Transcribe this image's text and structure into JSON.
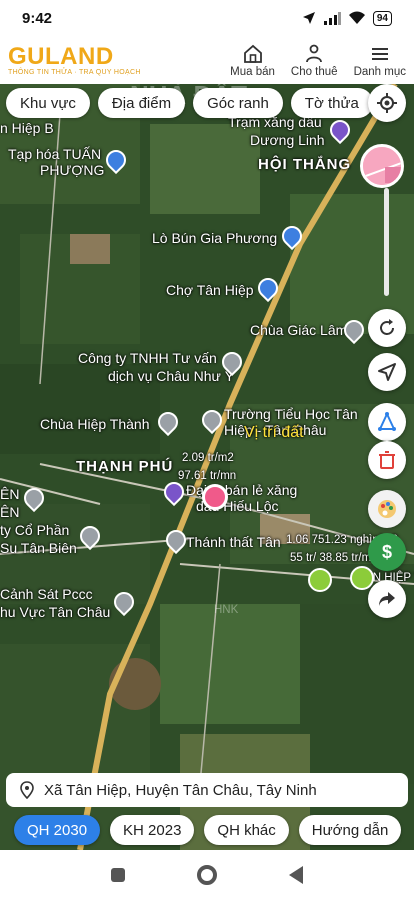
{
  "status_bar": {
    "time": "9:42",
    "battery": "94"
  },
  "header": {
    "logo_text": "GULAND",
    "logo_tagline": "THÔNG TIN THỬA · TRA QUY HOẠCH",
    "nav": [
      {
        "label": "Mua bán",
        "icon": "house-icon"
      },
      {
        "label": "Cho thuê",
        "icon": "person-key-icon"
      },
      {
        "label": "Danh mục",
        "icon": "menu-icon"
      }
    ]
  },
  "filters": [
    "Khu vực",
    "Địa điểm",
    "Góc ranh",
    "Tờ thửa"
  ],
  "map_labels": {
    "hiep_b": "n Hiệp B",
    "tram_xang": "Trạm xăng dầu",
    "duong_linh": "Dương Linh",
    "hoi_thang": "HỘI THẮNG",
    "tap_hoa": "Tạp hóa TUẤN",
    "tap_hoa_2": "PHƯỢNG",
    "lo_bun": "Lò Bún Gia Phương",
    "cho": "Chợ Tân Hiệp",
    "chua_giac_lam": "Chùa Giác Lâm",
    "cong_ty_1": "Công ty TNHH Tư vấn",
    "cong_ty_2": "dịch vụ Châu Như Ý",
    "chua_hiep_thanh": "Chùa Hiệp Thành",
    "truong_1": "Trường Tiểu Học Tân",
    "truong_2": "Hiệp - Tân Châu",
    "vi_tri_dat": "Vị trí đất",
    "thanh_phu": "THẠNH PHÚ",
    "price_1": "2.09 tr/m2",
    "price_2": "97.61 tr/mn",
    "dai_ly_1": "Đại lý bán lẻ xăng",
    "dai_ly_2": "dầu Hiếu Lộc",
    "cty_cp_1": "ty Cổ Phần",
    "cty_cp_2": "Su Tân Biên",
    "thanh_that": "Thánh thất Tân",
    "price_3": "1.06 751.23 nghìn/m2",
    "price_4": "55 tr/ 38.85 tr/m",
    "tan_hiep": "TÂN HIỆP T",
    "en_1": "ÊN",
    "en_2": "ÊN",
    "canh_sat_1": "Cảnh Sát Pccc",
    "canh_sat_2": "hu Vực Tân Châu",
    "watermark": "NHÀ ĐẤT",
    "hnk": "HNK"
  },
  "address": "Xã Tân Hiệp, Huyện Tân Châu, Tây Ninh",
  "plan_tabs": [
    {
      "label": "QH 2030",
      "active": true
    },
    {
      "label": "KH 2023",
      "active": false
    },
    {
      "label": "QH khác",
      "active": false
    },
    {
      "label": "Hướng dẫn",
      "active": false
    }
  ]
}
